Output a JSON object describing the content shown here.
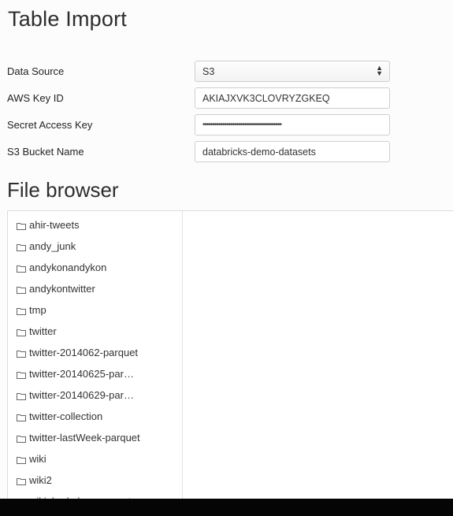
{
  "header": {
    "title": "Table Import"
  },
  "form": {
    "data_source": {
      "label": "Data Source",
      "value": "S3"
    },
    "aws_key_id": {
      "label": "AWS Key ID",
      "value": "AKIAJXVK3CLOVRYZGKEQ"
    },
    "secret_access_key": {
      "label": "Secret Access Key",
      "value": "••••••••••••••••••••••••••••••••••••••••"
    },
    "s3_bucket_name": {
      "label": "S3 Bucket Name",
      "value": "databricks-demo-datasets"
    }
  },
  "file_browser": {
    "title": "File browser",
    "folders": [
      "ahir-tweets",
      "andy_junk",
      "andykonandykon",
      "andykontwitter",
      "tmp",
      "twitter",
      "twitter-2014062-parquet",
      "twitter-20140625-par…",
      "twitter-20140629-par…",
      "twitter-collection",
      "twitter-lastWeek-parquet",
      "wiki",
      "wiki2",
      "wiki_berkeley_parquet"
    ]
  }
}
